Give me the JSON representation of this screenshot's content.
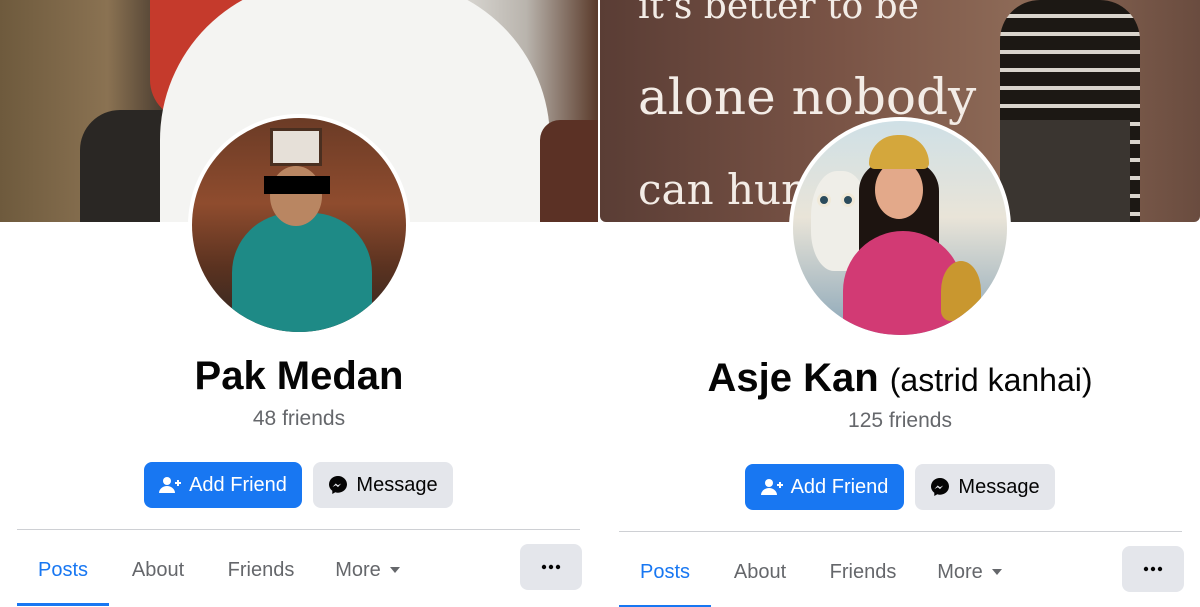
{
  "profiles": [
    {
      "name": "Pak Medan",
      "alt_name": "",
      "friends": "48 friends",
      "add_friend": "Add Friend",
      "message": "Message",
      "tabs": [
        "Posts",
        "About",
        "Friends",
        "More"
      ],
      "active_tab": "Posts"
    },
    {
      "name": "Asje Kan",
      "alt_name": "(astrid kanhai)",
      "friends": "125 friends",
      "add_friend": "Add Friend",
      "message": "Message",
      "tabs": [
        "Posts",
        "About",
        "Friends",
        "More"
      ],
      "active_tab": "Posts",
      "cover_text": [
        "it's better to be",
        "alone nobody",
        "can hurt"
      ]
    }
  ],
  "icons": {
    "add_friend": "add-person-icon",
    "message": "messenger-icon",
    "more_dropdown": "caret-down-icon",
    "options": "ellipsis-icon"
  },
  "colors": {
    "primary": "#1877f2",
    "secondary_bg": "#e4e6eb",
    "muted_text": "#65676b",
    "text": "#050505"
  }
}
